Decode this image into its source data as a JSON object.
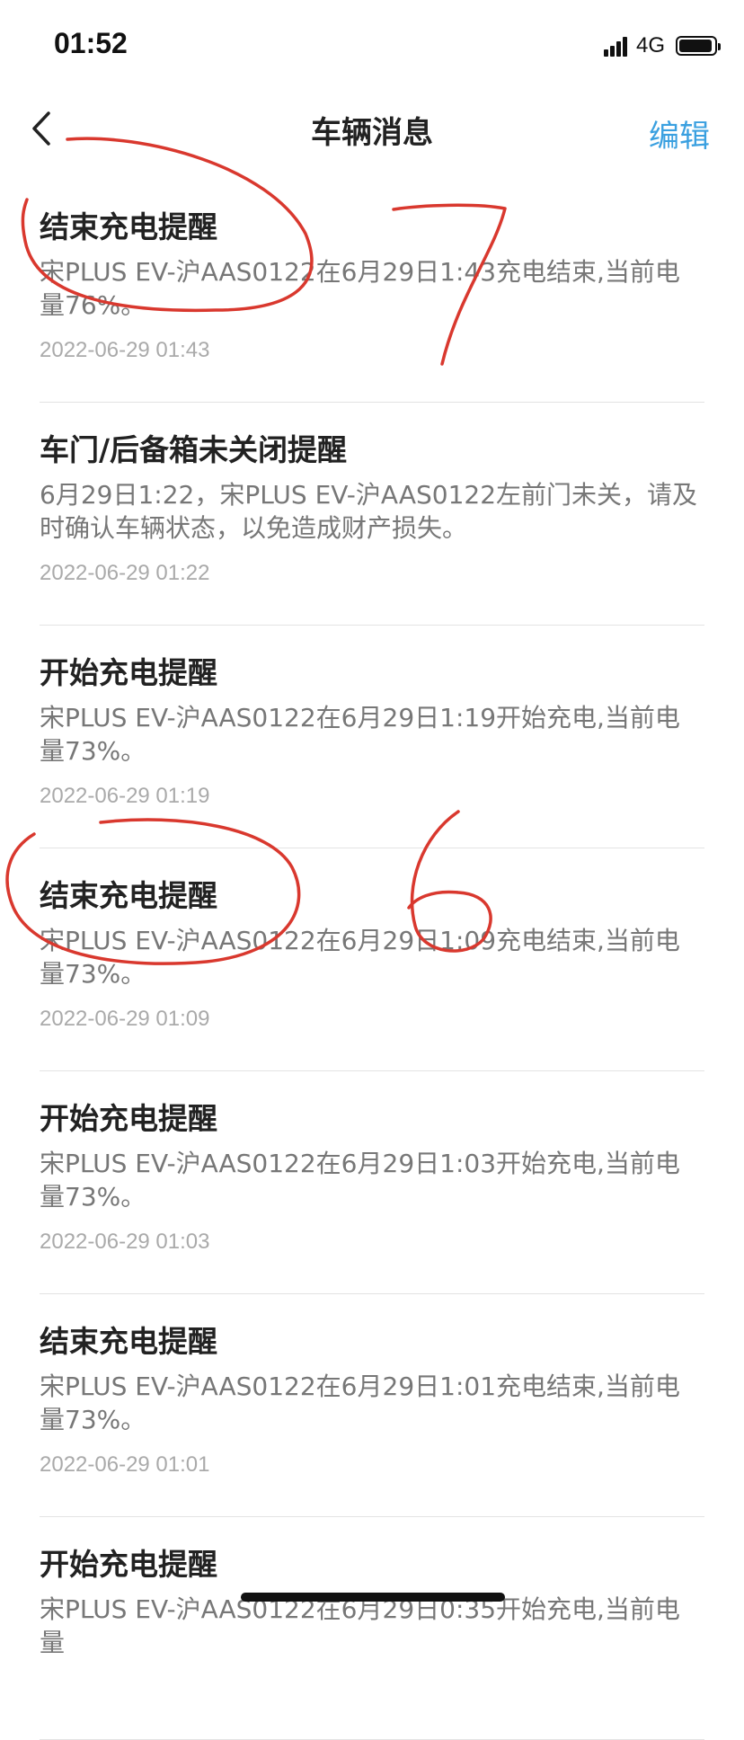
{
  "status_bar": {
    "time": "01:52",
    "network": "4G",
    "battery_level": 0.95
  },
  "nav": {
    "title": "车辆消息",
    "edit_label": "编辑"
  },
  "messages": [
    {
      "title": "结束充电提醒",
      "body": "宋PLUS EV-沪AAS0122在6月29日1:43充电结束,当前电量76%。",
      "time": "2022-06-29 01:43"
    },
    {
      "title": "车门/后备箱未关闭提醒",
      "body": "6月29日1:22，宋PLUS EV-沪AAS0122左前门未关，请及时确认车辆状态，以免造成财产损失。",
      "time": "2022-06-29 01:22"
    },
    {
      "title": "开始充电提醒",
      "body": "宋PLUS EV-沪AAS0122在6月29日1:19开始充电,当前电量73%。",
      "time": "2022-06-29 01:19"
    },
    {
      "title": "结束充电提醒",
      "body": "宋PLUS EV-沪AAS0122在6月29日1:09充电结束,当前电量73%。",
      "time": "2022-06-29 01:09"
    },
    {
      "title": "开始充电提醒",
      "body": "宋PLUS EV-沪AAS0122在6月29日1:03开始充电,当前电量73%。",
      "time": "2022-06-29 01:03"
    },
    {
      "title": "结束充电提醒",
      "body": "宋PLUS EV-沪AAS0122在6月29日1:01充电结束,当前电量73%。",
      "time": "2022-06-29 01:01"
    },
    {
      "title": "开始充电提醒",
      "body": "宋PLUS EV-沪AAS0122在6月29日0:35开始充电,当前电量",
      "time": ""
    }
  ],
  "annotations": {
    "color": "#d9382e",
    "marks": [
      "7",
      "6"
    ]
  }
}
